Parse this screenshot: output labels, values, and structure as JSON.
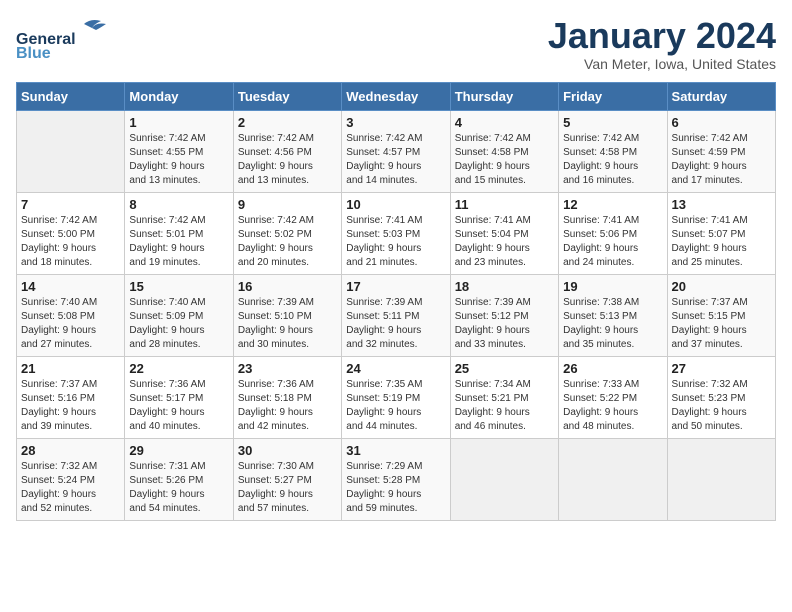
{
  "header": {
    "logo_line1": "General",
    "logo_line2": "Blue",
    "title": "January 2024",
    "subtitle": "Van Meter, Iowa, United States"
  },
  "weekdays": [
    "Sunday",
    "Monday",
    "Tuesday",
    "Wednesday",
    "Thursday",
    "Friday",
    "Saturday"
  ],
  "weeks": [
    [
      {
        "num": "",
        "info": ""
      },
      {
        "num": "1",
        "info": "Sunrise: 7:42 AM\nSunset: 4:55 PM\nDaylight: 9 hours\nand 13 minutes."
      },
      {
        "num": "2",
        "info": "Sunrise: 7:42 AM\nSunset: 4:56 PM\nDaylight: 9 hours\nand 13 minutes."
      },
      {
        "num": "3",
        "info": "Sunrise: 7:42 AM\nSunset: 4:57 PM\nDaylight: 9 hours\nand 14 minutes."
      },
      {
        "num": "4",
        "info": "Sunrise: 7:42 AM\nSunset: 4:58 PM\nDaylight: 9 hours\nand 15 minutes."
      },
      {
        "num": "5",
        "info": "Sunrise: 7:42 AM\nSunset: 4:58 PM\nDaylight: 9 hours\nand 16 minutes."
      },
      {
        "num": "6",
        "info": "Sunrise: 7:42 AM\nSunset: 4:59 PM\nDaylight: 9 hours\nand 17 minutes."
      }
    ],
    [
      {
        "num": "7",
        "info": "Sunrise: 7:42 AM\nSunset: 5:00 PM\nDaylight: 9 hours\nand 18 minutes."
      },
      {
        "num": "8",
        "info": "Sunrise: 7:42 AM\nSunset: 5:01 PM\nDaylight: 9 hours\nand 19 minutes."
      },
      {
        "num": "9",
        "info": "Sunrise: 7:42 AM\nSunset: 5:02 PM\nDaylight: 9 hours\nand 20 minutes."
      },
      {
        "num": "10",
        "info": "Sunrise: 7:41 AM\nSunset: 5:03 PM\nDaylight: 9 hours\nand 21 minutes."
      },
      {
        "num": "11",
        "info": "Sunrise: 7:41 AM\nSunset: 5:04 PM\nDaylight: 9 hours\nand 23 minutes."
      },
      {
        "num": "12",
        "info": "Sunrise: 7:41 AM\nSunset: 5:06 PM\nDaylight: 9 hours\nand 24 minutes."
      },
      {
        "num": "13",
        "info": "Sunrise: 7:41 AM\nSunset: 5:07 PM\nDaylight: 9 hours\nand 25 minutes."
      }
    ],
    [
      {
        "num": "14",
        "info": "Sunrise: 7:40 AM\nSunset: 5:08 PM\nDaylight: 9 hours\nand 27 minutes."
      },
      {
        "num": "15",
        "info": "Sunrise: 7:40 AM\nSunset: 5:09 PM\nDaylight: 9 hours\nand 28 minutes."
      },
      {
        "num": "16",
        "info": "Sunrise: 7:39 AM\nSunset: 5:10 PM\nDaylight: 9 hours\nand 30 minutes."
      },
      {
        "num": "17",
        "info": "Sunrise: 7:39 AM\nSunset: 5:11 PM\nDaylight: 9 hours\nand 32 minutes."
      },
      {
        "num": "18",
        "info": "Sunrise: 7:39 AM\nSunset: 5:12 PM\nDaylight: 9 hours\nand 33 minutes."
      },
      {
        "num": "19",
        "info": "Sunrise: 7:38 AM\nSunset: 5:13 PM\nDaylight: 9 hours\nand 35 minutes."
      },
      {
        "num": "20",
        "info": "Sunrise: 7:37 AM\nSunset: 5:15 PM\nDaylight: 9 hours\nand 37 minutes."
      }
    ],
    [
      {
        "num": "21",
        "info": "Sunrise: 7:37 AM\nSunset: 5:16 PM\nDaylight: 9 hours\nand 39 minutes."
      },
      {
        "num": "22",
        "info": "Sunrise: 7:36 AM\nSunset: 5:17 PM\nDaylight: 9 hours\nand 40 minutes."
      },
      {
        "num": "23",
        "info": "Sunrise: 7:36 AM\nSunset: 5:18 PM\nDaylight: 9 hours\nand 42 minutes."
      },
      {
        "num": "24",
        "info": "Sunrise: 7:35 AM\nSunset: 5:19 PM\nDaylight: 9 hours\nand 44 minutes."
      },
      {
        "num": "25",
        "info": "Sunrise: 7:34 AM\nSunset: 5:21 PM\nDaylight: 9 hours\nand 46 minutes."
      },
      {
        "num": "26",
        "info": "Sunrise: 7:33 AM\nSunset: 5:22 PM\nDaylight: 9 hours\nand 48 minutes."
      },
      {
        "num": "27",
        "info": "Sunrise: 7:32 AM\nSunset: 5:23 PM\nDaylight: 9 hours\nand 50 minutes."
      }
    ],
    [
      {
        "num": "28",
        "info": "Sunrise: 7:32 AM\nSunset: 5:24 PM\nDaylight: 9 hours\nand 52 minutes."
      },
      {
        "num": "29",
        "info": "Sunrise: 7:31 AM\nSunset: 5:26 PM\nDaylight: 9 hours\nand 54 minutes."
      },
      {
        "num": "30",
        "info": "Sunrise: 7:30 AM\nSunset: 5:27 PM\nDaylight: 9 hours\nand 57 minutes."
      },
      {
        "num": "31",
        "info": "Sunrise: 7:29 AM\nSunset: 5:28 PM\nDaylight: 9 hours\nand 59 minutes."
      },
      {
        "num": "",
        "info": ""
      },
      {
        "num": "",
        "info": ""
      },
      {
        "num": "",
        "info": ""
      }
    ]
  ]
}
